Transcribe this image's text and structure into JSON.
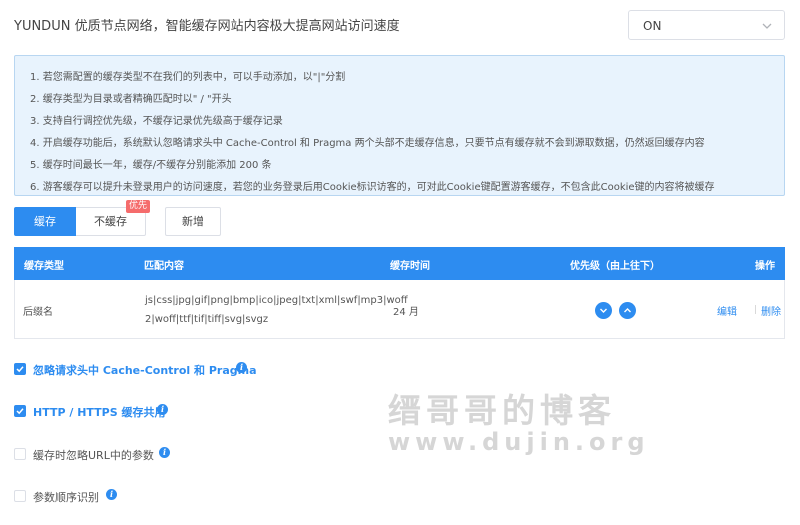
{
  "header": {
    "title": "YUNDUN 优质节点网络，智能缓存网站内容极大提高网站访问速度"
  },
  "status_select": {
    "value": "ON"
  },
  "notice": {
    "lines": [
      "1. 若您需配置的缓存类型不在我们的列表中，可以手动添加，以\"|\"分割",
      "2. 缓存类型为目录或者精确匹配时以\" / \"开头",
      "3. 支持自行调控优先级，不缓存记录优先级高于缓存记录",
      "4. 开启缓存功能后，系统默认忽略请求头中 Cache-Control 和 Pragma 两个头部不走缓存信息，只要节点有缓存就不会到源取数据，仍然返回缓存内容",
      "5. 缓存时间最长一年，缓存/不缓存分别能添加 200 条",
      "6. 游客缓存可以提升未登录用户的访问速度，若您的业务登录后用Cookie标识访客的，可对此Cookie键配置游客缓存，不包含此Cookie键的内容将被缓存"
    ]
  },
  "tabs": {
    "cache": "缓存",
    "nocache": "不缓存",
    "badge": "优先"
  },
  "add_button": "新增",
  "table": {
    "headers": {
      "type": "缓存类型",
      "match": "匹配内容",
      "time": "缓存时间",
      "priority": "优先级（由上往下）",
      "ops": "操作"
    },
    "row": {
      "type": "后缀名",
      "match_line1": "js|css|jpg|gif|png|bmp|ico|jpeg|txt|xml|swf|mp3|woff",
      "match_line2": "2|woff|ttf|tif|tiff|svg|svgz",
      "time": "24 月",
      "edit": "编辑",
      "delete": "删除"
    }
  },
  "options": [
    {
      "label": "忽略请求头中 Cache-Control 和 Pragma",
      "checked": true
    },
    {
      "label": "HTTP / HTTPS 缓存共用",
      "checked": true
    },
    {
      "label": "缓存时忽略URL中的参数",
      "checked": false
    },
    {
      "label": "参数顺序识别",
      "checked": false
    }
  ],
  "info_glyph": "i",
  "watermark": {
    "cn": "缙哥哥的博客",
    "en": "www.dujin.org"
  },
  "colors": {
    "accent": "#2d8cf0",
    "badge": "#f56c6c",
    "notice_bg": "#e8f3fd"
  }
}
